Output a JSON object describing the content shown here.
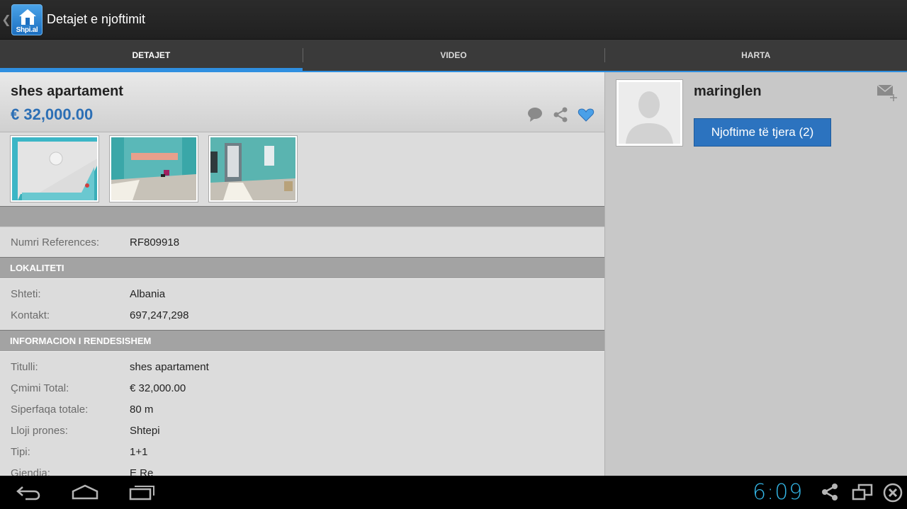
{
  "app": {
    "logo_text": "Shpi.al",
    "title": "Detajet e njoftimit"
  },
  "tabs": [
    {
      "label": "DETAJET",
      "active": true
    },
    {
      "label": "VIDEO",
      "active": false
    },
    {
      "label": "HARTA",
      "active": false
    }
  ],
  "listing": {
    "title": "shes apartament",
    "price": "€ 32,000.00",
    "reference": {
      "label": "Numri References:",
      "value": "RF809918"
    }
  },
  "sections": {
    "location": {
      "header": "LOKALITETI",
      "rows": [
        {
          "label": "Shteti:",
          "value": "Albania"
        },
        {
          "label": "Kontakt:",
          "value": "697,247,298"
        }
      ]
    },
    "important": {
      "header": "INFORMACION I RENDESISHEM",
      "rows": [
        {
          "label": "Titulli:",
          "value": "shes apartament"
        },
        {
          "label": "Çmimi Total:",
          "value": "€ 32,000.00"
        },
        {
          "label": "Siperfaqa totale:",
          "value": "80 m"
        },
        {
          "label": "Lloji prones:",
          "value": "Shtepi"
        },
        {
          "label": "Tipi:",
          "value": "1+1"
        },
        {
          "label": "Gjendja:",
          "value": "E Re"
        }
      ]
    }
  },
  "seller": {
    "name": "maringlen",
    "more_button": "Njoftime të tjera (2)"
  },
  "status": {
    "clock": "6:09"
  },
  "colors": {
    "accent": "#2f8fe0",
    "price": "#2c6fb5",
    "button": "#2c73bf",
    "clock": "#33b5e5",
    "favorite": "#4aa0e8"
  }
}
